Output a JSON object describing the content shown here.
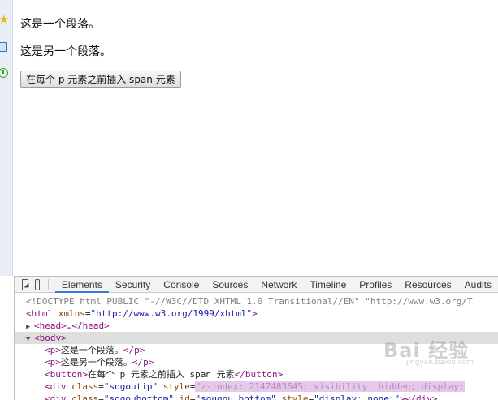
{
  "sidebar": {
    "icons": [
      "star-icon",
      "note-icon",
      "clock-icon"
    ]
  },
  "page": {
    "paragraph1": "这是一个段落。",
    "paragraph2": "这是另一个段落。",
    "button_label": "在每个 p 元素之前插入 span 元素"
  },
  "devtools": {
    "tabs": [
      "Elements",
      "Security",
      "Console",
      "Sources",
      "Network",
      "Timeline",
      "Profiles",
      "Resources",
      "Audits"
    ],
    "active_tab": "Elements",
    "lines": {
      "doctype": "<!DOCTYPE html PUBLIC \"-//W3C//DTD XHTML 1.0 Transitional//EN\" \"http://www.w3.org/T",
      "html_open_tag": "<html",
      "html_attr": "xmlns",
      "html_attr_value": "\"http://www.w3.org/1999/xhtml\"",
      "html_close": ">",
      "head_collapsed": "<head>…</head>",
      "body_open": "<body>",
      "p1_open": "<p>",
      "p1_text": "这是一个段落。",
      "p1_close": "</p>",
      "p2_open": "<p>",
      "p2_text": "这是另一个段落。",
      "p2_close": "</p>",
      "button_open": "<button>",
      "button_text": "在每个 p 元素之前插入 span 元素",
      "button_close": "</button>",
      "div1_open": "<div",
      "div1_attr_class": "class",
      "div1_class_value": "\"sogoutip\"",
      "div1_attr_style": "style",
      "div1_style_value": "\"z-index: 2147483645; visibility: hidden; display: ",
      "div2_open": "<div",
      "div2_attr_class": "class",
      "div2_class_value": "\"sogoubottom\"",
      "div2_attr_id": "id",
      "div2_id_value": "\"sougou_bottom\"",
      "div2_attr_style": "style",
      "div2_style_value": "\"display: none;\"",
      "div2_close": "></div>"
    }
  },
  "watermark": {
    "main": "Bai 经验",
    "sub": "jingyan.baidu.com"
  },
  "colors": {
    "tag": "#881280",
    "attr": "#994500",
    "attr_value": "#1a1aa6",
    "selected_row": "#dedede",
    "active_tab_underline": "#3879d9"
  }
}
